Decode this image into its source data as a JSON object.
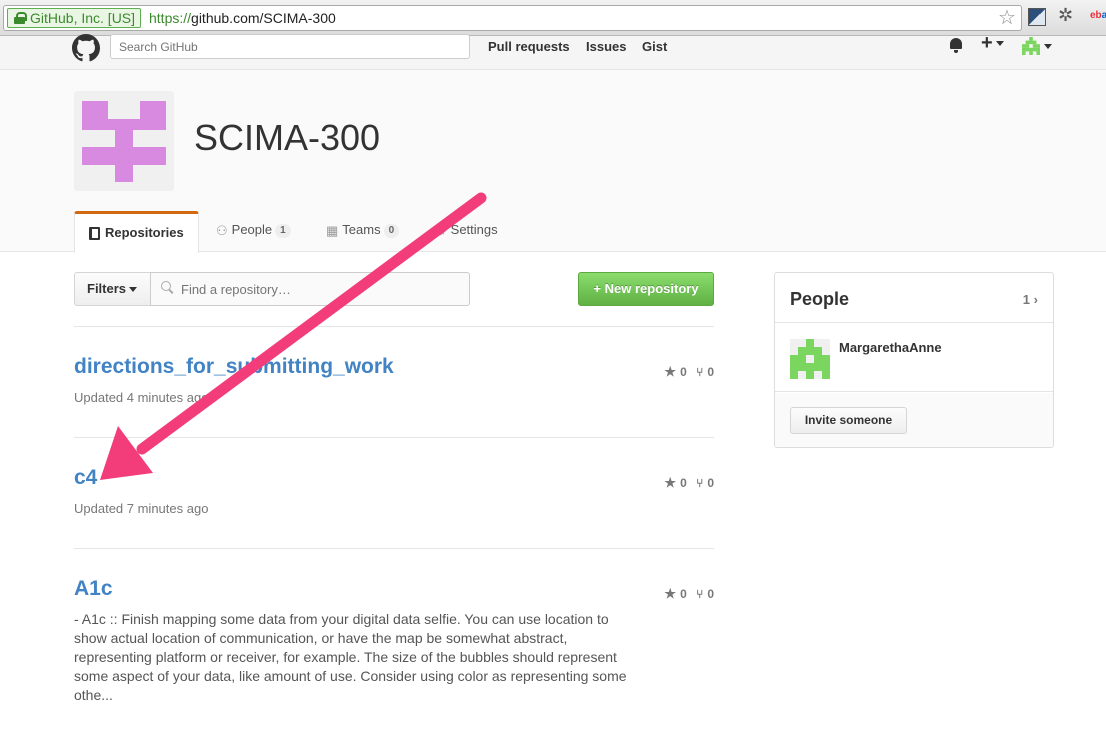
{
  "browser": {
    "ev_label": "GitHub, Inc. [US]",
    "url_scheme": "https://",
    "url_rest": "github.com/SCIMA-300",
    "ext_ebay_1": "eb",
    "ext_ebay_2": "ay"
  },
  "header": {
    "search_placeholder": "Search GitHub",
    "nav": [
      "Pull requests",
      "Issues",
      "Gist"
    ],
    "plus": "+"
  },
  "org": {
    "name": "SCIMA-300",
    "tabs": [
      {
        "label": "Repositories",
        "icon": "book-icon"
      },
      {
        "label": "People",
        "count": "1",
        "icon": "people-icon"
      },
      {
        "label": "Teams",
        "count": "0",
        "icon": "team-icon"
      },
      {
        "label": "Settings",
        "icon": "gear-icon"
      }
    ]
  },
  "filters": {
    "label": "Filters",
    "placeholder": "Find a repository…",
    "new_repo": "New repository"
  },
  "repos": [
    {
      "name": "directions_for_submitting_work",
      "updated": "Updated 4 minutes ago",
      "stars": "0",
      "forks": "0"
    },
    {
      "name": "c4",
      "updated": "Updated 7 minutes ago",
      "stars": "0",
      "forks": "0"
    },
    {
      "name": "A1c",
      "description": "- A1c :: Finish mapping some data from your digital data selfie. You can use location to show actual location of communication, or have the map be somewhat abstract, representing platform or receiver, for example. The size of the bubbles should represent some aspect of your data, like amount of use. Consider using color as representing some othe...",
      "stars": "0",
      "forks": "0"
    }
  ],
  "sidebar": {
    "title": "People",
    "count": "1",
    "member": "MargarethaAnne",
    "invite": "Invite someone"
  },
  "colors": {
    "link": "#4183c4",
    "accent_tab": "#d26911",
    "green_button": "#60b044",
    "org_avatar": "#d88ae0",
    "user_avatar": "#7bd65f",
    "annotation_arrow": "#f23d7a"
  }
}
